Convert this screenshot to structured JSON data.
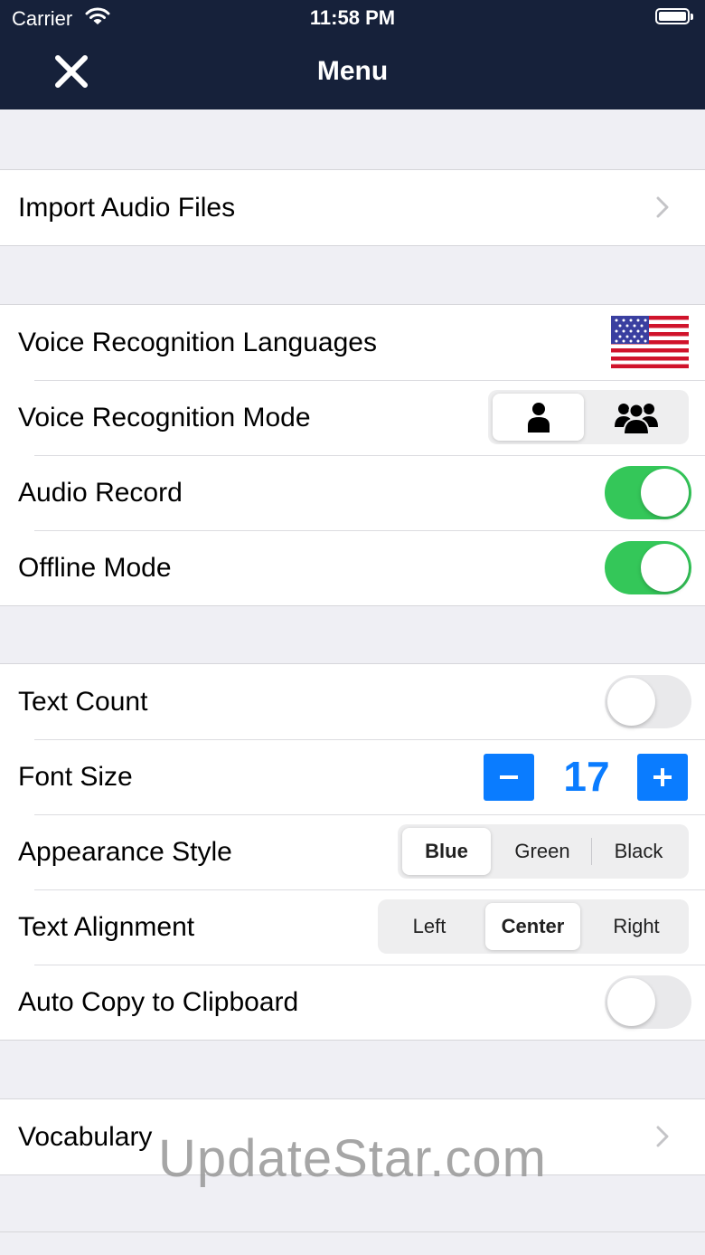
{
  "status_bar": {
    "carrier": "Carrier",
    "time": "11:58 PM"
  },
  "nav": {
    "title": "Menu"
  },
  "import": {
    "label": "Import Audio Files"
  },
  "voice": {
    "languages_label": "Voice Recognition Languages",
    "mode_label": "Voice Recognition Mode",
    "mode_options": [
      "single-person-icon",
      "group-icon"
    ],
    "mode_selected": 0,
    "audio_record_label": "Audio Record",
    "audio_record_on": true,
    "offline_mode_label": "Offline Mode",
    "offline_mode_on": true
  },
  "display": {
    "text_count_label": "Text Count",
    "text_count_on": false,
    "font_size_label": "Font Size",
    "font_size_value": "17",
    "font_size_minus": "−",
    "font_size_plus": "+",
    "appearance_label": "Appearance Style",
    "appearance_options": [
      "Blue",
      "Green",
      "Black"
    ],
    "appearance_selected": "Blue",
    "alignment_label": "Text Alignment",
    "alignment_options": [
      "Left",
      "Center",
      "Right"
    ],
    "alignment_selected": "Center",
    "auto_copy_label": "Auto Copy to Clipboard",
    "auto_copy_on": false
  },
  "vocabulary": {
    "label": "Vocabulary"
  },
  "watermark": "UpdateStar.com",
  "colors": {
    "header_bg": "#16213a",
    "toggle_on": "#34c759",
    "accent": "#0a7cff",
    "background": "#efeff4"
  }
}
